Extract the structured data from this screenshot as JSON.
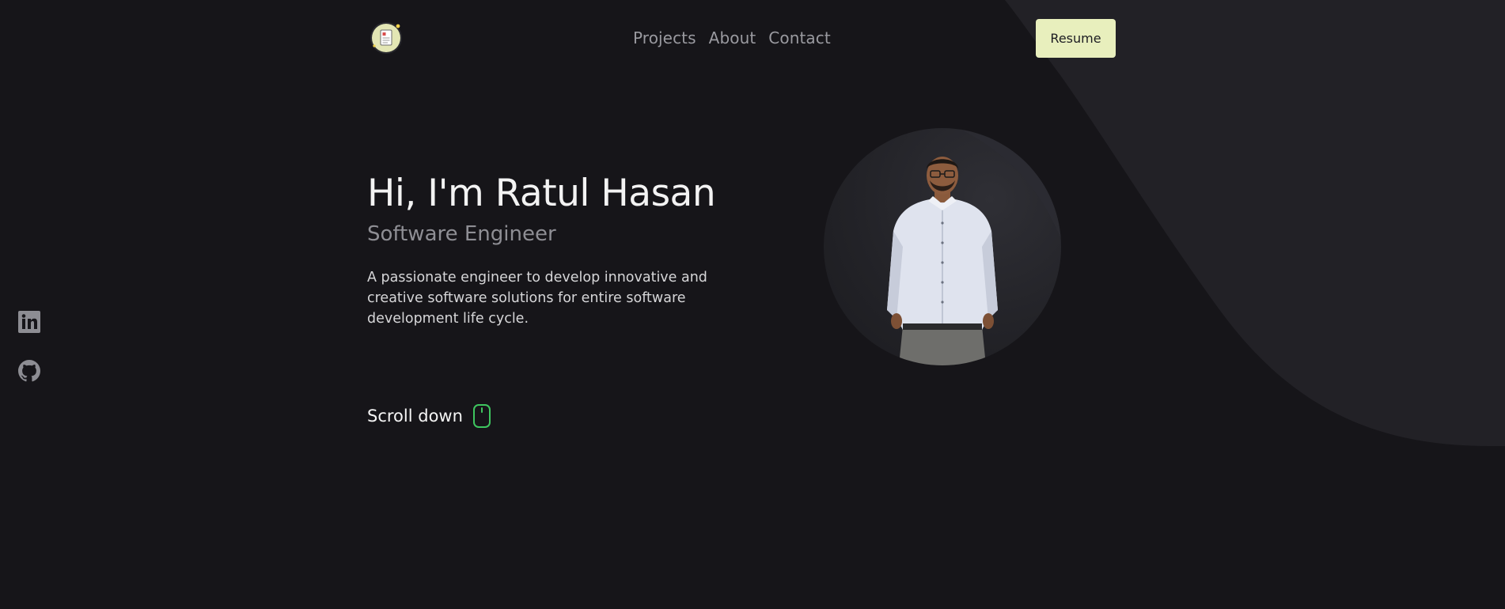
{
  "colors": {
    "background": "#161519",
    "shape": "#222126",
    "accent_button": "#e8efbd",
    "mouse_icon": "#3ec55f",
    "nav_text": "#9a9aa0"
  },
  "header": {
    "logo_icon": "document-badge-icon",
    "nav": [
      "Projects",
      "About",
      "Contact"
    ],
    "resume_label": "Resume"
  },
  "hero": {
    "title": "Hi, I'm Ratul Hasan",
    "subtitle": "Software Engineer",
    "description": "A passionate engineer to develop innovative and creative software solutions for entire software development life cycle.",
    "scroll_label": "Scroll down",
    "scroll_icon": "mouse-icon"
  },
  "profile": {
    "image_description": "profile-photo"
  },
  "social": [
    "linkedin-icon",
    "github-icon"
  ]
}
